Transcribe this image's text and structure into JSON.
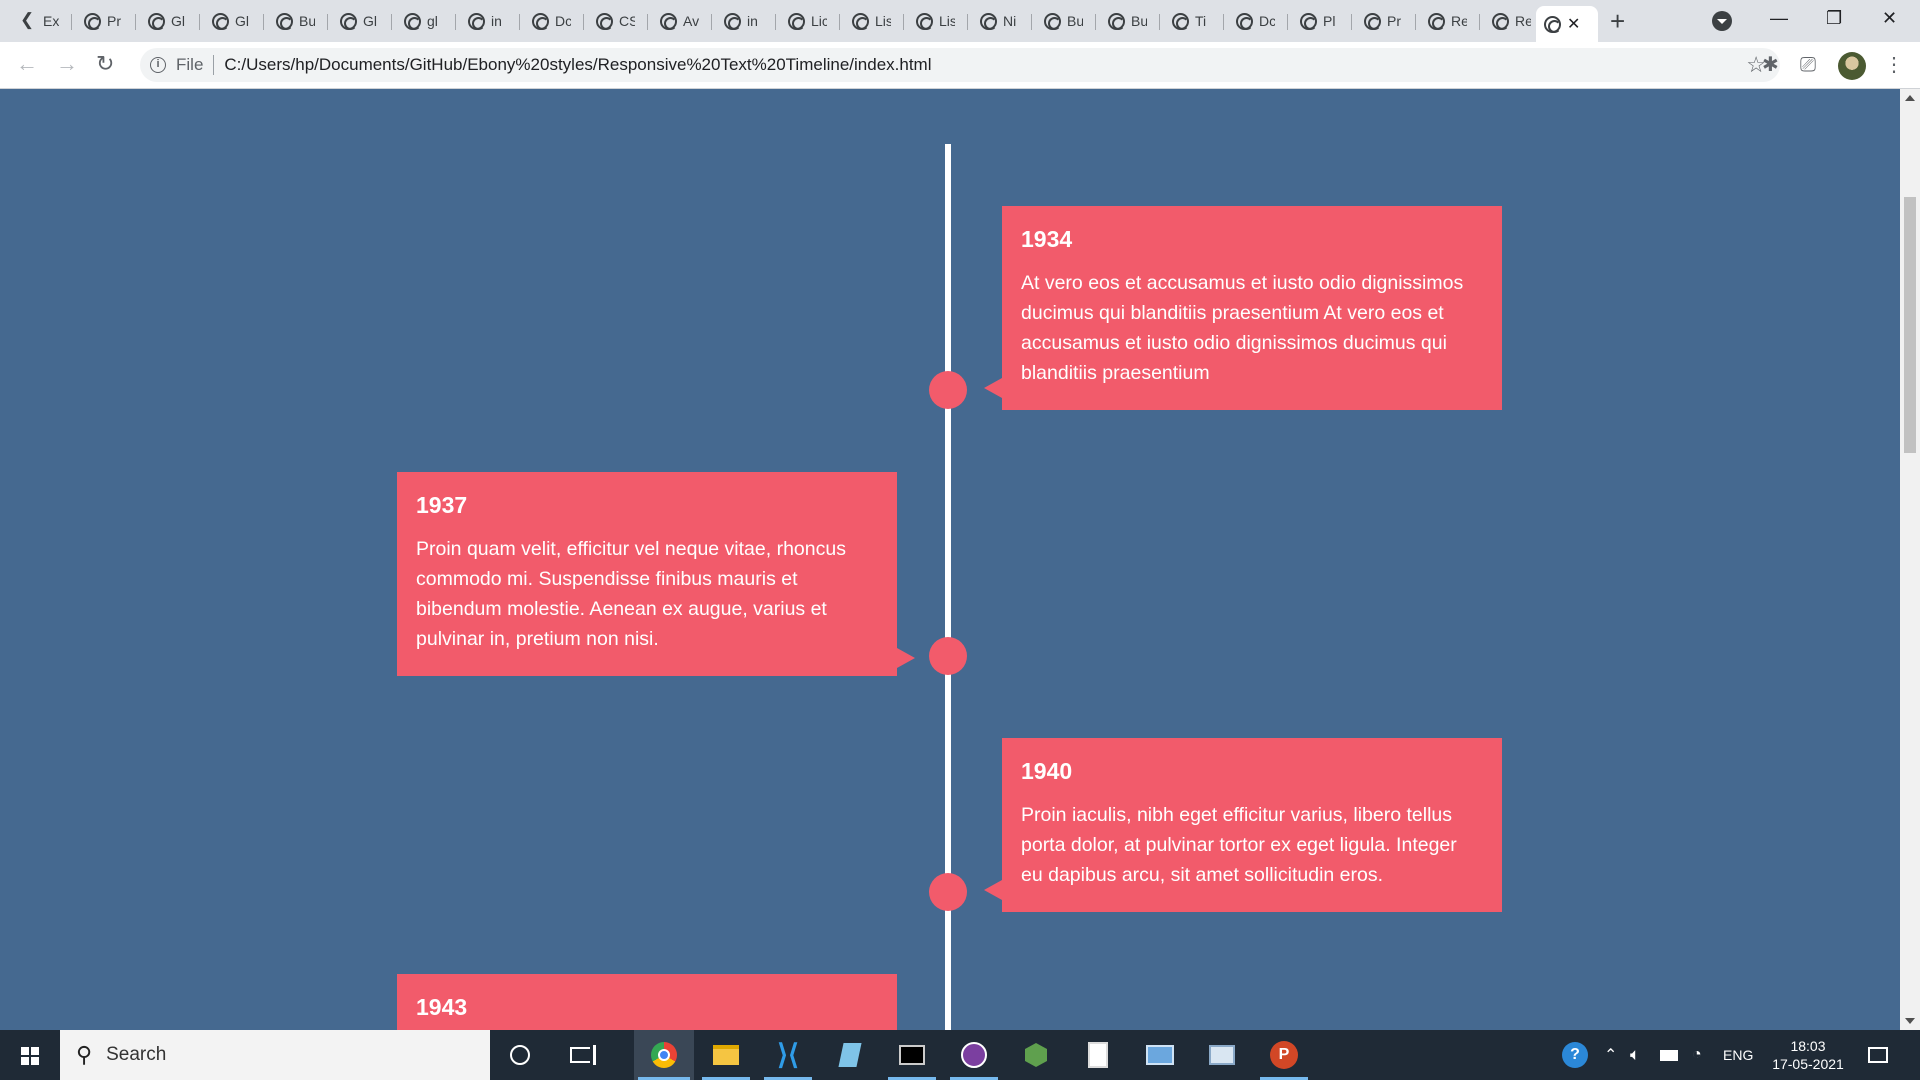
{
  "browser": {
    "tabs": [
      {
        "label": "Ex",
        "icon": "arrow-favicon-icon"
      },
      {
        "label": "Pr",
        "icon": "globe-icon"
      },
      {
        "label": "Gl",
        "icon": "globe-icon"
      },
      {
        "label": "Gl",
        "icon": "globe-icon"
      },
      {
        "label": "Bu",
        "icon": "globe-icon"
      },
      {
        "label": "Gl",
        "icon": "globe-icon"
      },
      {
        "label": "gl",
        "icon": "globe-icon"
      },
      {
        "label": "in",
        "icon": "globe-icon"
      },
      {
        "label": "Dc",
        "icon": "globe-icon"
      },
      {
        "label": "CS",
        "icon": "globe-icon"
      },
      {
        "label": "Av",
        "icon": "globe-icon"
      },
      {
        "label": "in",
        "icon": "globe-icon"
      },
      {
        "label": "Lic",
        "icon": "globe-icon"
      },
      {
        "label": "Lis",
        "icon": "globe-icon"
      },
      {
        "label": "Lis",
        "icon": "globe-icon"
      },
      {
        "label": "Ni",
        "icon": "globe-icon"
      },
      {
        "label": "Bu",
        "icon": "globe-icon"
      },
      {
        "label": "Bu",
        "icon": "globe-icon"
      },
      {
        "label": "Ti",
        "icon": "globe-icon"
      },
      {
        "label": "Dc",
        "icon": "globe-icon"
      },
      {
        "label": "Pl",
        "icon": "globe-icon"
      },
      {
        "label": "Pr",
        "icon": "globe-icon"
      },
      {
        "label": "Re",
        "icon": "globe-icon"
      },
      {
        "label": "Re",
        "icon": "globe-icon"
      }
    ],
    "active_tab_close": "✕",
    "new_tab": "+",
    "address": {
      "scheme": "File",
      "url": "C:/Users/hp/Documents/GitHub/Ebony%20styles/Responsive%20Text%20Timeline/index.html"
    }
  },
  "timeline": {
    "accent_color": "#f25b6b",
    "background_color": "#456990",
    "events": [
      {
        "year": "1934",
        "side": "right",
        "text": "At vero eos et accusamus et iusto odio dignissimos ducimus qui blanditiis praesentium At vero eos et accusamus et iusto odio dignissimos ducimus qui blanditiis praesentium"
      },
      {
        "year": "1937",
        "side": "left",
        "text": "Proin quam velit, efficitur vel neque vitae, rhoncus commodo mi. Suspendisse finibus mauris et bibendum molestie. Aenean ex augue, varius et pulvinar in, pretium non nisi."
      },
      {
        "year": "1940",
        "side": "right",
        "text": "Proin iaculis, nibh eget efficitur varius, libero tellus porta dolor, at pulvinar tortor ex eget ligula. Integer eu dapibus arcu, sit amet sollicitudin eros."
      },
      {
        "year": "1943",
        "side": "left",
        "text": ""
      }
    ]
  },
  "taskbar": {
    "search_placeholder": "Search",
    "language": "ENG",
    "time": "18:03",
    "date": "17-05-2021"
  }
}
